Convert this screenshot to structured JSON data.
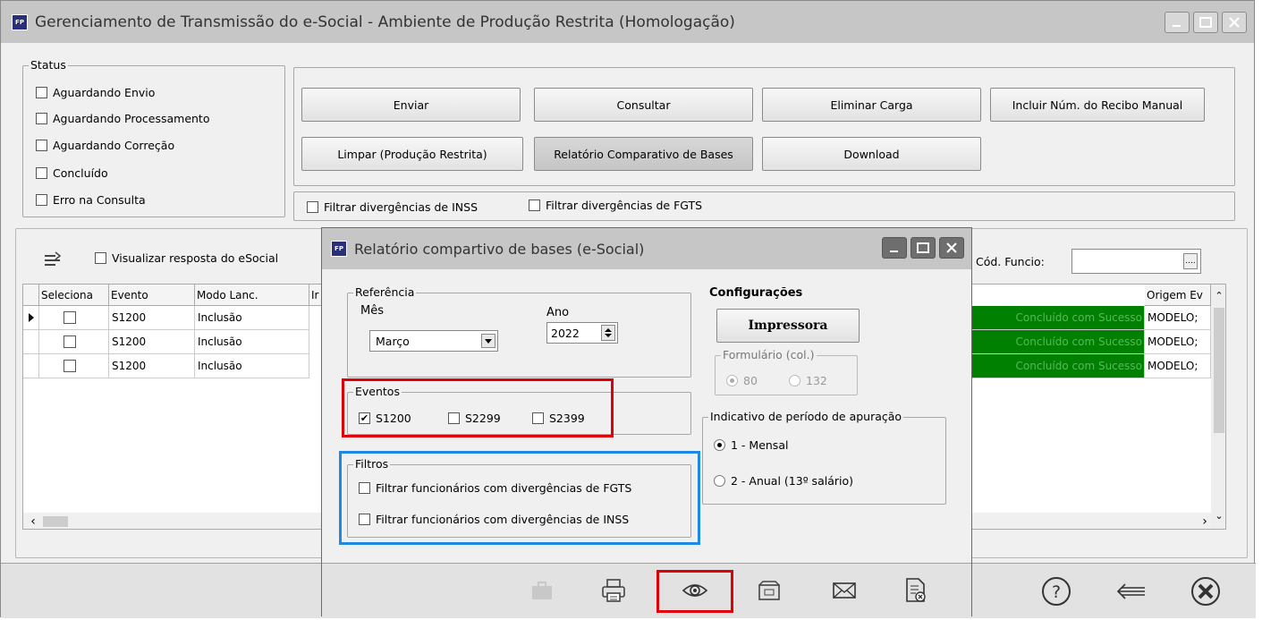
{
  "window": {
    "title": "Gerenciamento de Transmissão do e-Social - Ambiente de Produção Restrita (Homologação)",
    "logo": "FP"
  },
  "status": {
    "title": "Status",
    "items": [
      "Aguardando Envio",
      "Aguardando Processamento",
      "Aguardando Correção",
      "Concluído",
      "Erro na Consulta"
    ]
  },
  "buttons": {
    "enviar": "Enviar",
    "consultar": "Consultar",
    "eliminar": "Eliminar Carga",
    "incluir": "Incluir Núm. do Recibo Manual",
    "limpar": "Limpar (Produção Restrita)",
    "relatorio": "Relatório Comparativo de Bases",
    "download": "Download"
  },
  "filters": {
    "inss": "Filtrar divergências de INSS",
    "fgts": "Filtrar divergências de FGTS"
  },
  "panel": {
    "visualizar": "Visualizar resposta do eSocial",
    "cod_funcio": "Cód. Funcio:",
    "cod_funcio_value": "",
    "lookup": "...."
  },
  "grid": {
    "headers": [
      "Seleciona",
      "Evento",
      "Modo Lanc.",
      "Ir"
    ],
    "right_header": "Origem Ev",
    "rows": [
      {
        "evento": "S1200",
        "modo": "Inclusão",
        "status": "Concluído com Sucesso",
        "origem": "MODELO;"
      },
      {
        "evento": "S1200",
        "modo": "Inclusão",
        "status": "Concluído com Sucesso",
        "origem": "MODELO;"
      },
      {
        "evento": "S1200",
        "modo": "Inclusão",
        "status": "Concluído com Sucesso",
        "origem": "MODELO;"
      }
    ]
  },
  "dialog": {
    "title": "Relatório compartivo de bases (e-Social)",
    "referencia": {
      "title": "Referência",
      "mes_label": "Mês",
      "mes_value": "Março",
      "ano_label": "Ano",
      "ano_value": "2022"
    },
    "configuracoes": {
      "title": "Configurações",
      "impressora": "Impressora",
      "formulario": "Formulário (col.)",
      "opt80": "80",
      "opt132": "132"
    },
    "eventos": {
      "title": "Eventos",
      "items": [
        {
          "label": "S1200",
          "checked": true
        },
        {
          "label": "S2299",
          "checked": false
        },
        {
          "label": "S2399",
          "checked": false
        }
      ]
    },
    "indicativo": {
      "title": "Indicativo de período de apuração",
      "opt1": "1 - Mensal",
      "opt2": "2 - Anual (13º salário)",
      "selected": "1 - Mensal"
    },
    "filtros": {
      "title": "Filtros",
      "fgts": "Filtrar funcionários com divergências de FGTS",
      "inss": "Filtrar funcionários com divergências de INSS"
    }
  },
  "colors": {
    "highlight_red": "#e0000a",
    "highlight_blue": "#1e88e5",
    "status_green": "#008000"
  }
}
